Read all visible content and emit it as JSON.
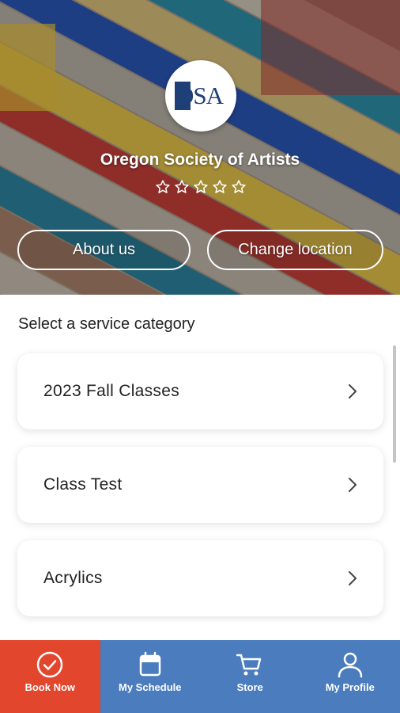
{
  "header": {
    "logo_text": "OSA",
    "org_name": "Oregon Society of Artists",
    "rating_stars": 0,
    "rating_max": 5,
    "about_label": "About us",
    "location_label": "Change location"
  },
  "main": {
    "section_title": "Select a service category",
    "categories": [
      {
        "label": "2023 Fall Classes"
      },
      {
        "label": "Class Test"
      },
      {
        "label": "Acrylics"
      }
    ]
  },
  "nav": {
    "items": [
      {
        "label": "Book Now",
        "icon": "check-circle-icon",
        "active": true
      },
      {
        "label": "My Schedule",
        "icon": "calendar-icon",
        "active": false
      },
      {
        "label": "Store",
        "icon": "cart-icon",
        "active": false
      },
      {
        "label": "My Profile",
        "icon": "user-icon",
        "active": false
      }
    ]
  },
  "colors": {
    "nav_background": "#4a7cbe",
    "nav_active": "#e2462c",
    "logo_blue": "#1f3f78"
  }
}
